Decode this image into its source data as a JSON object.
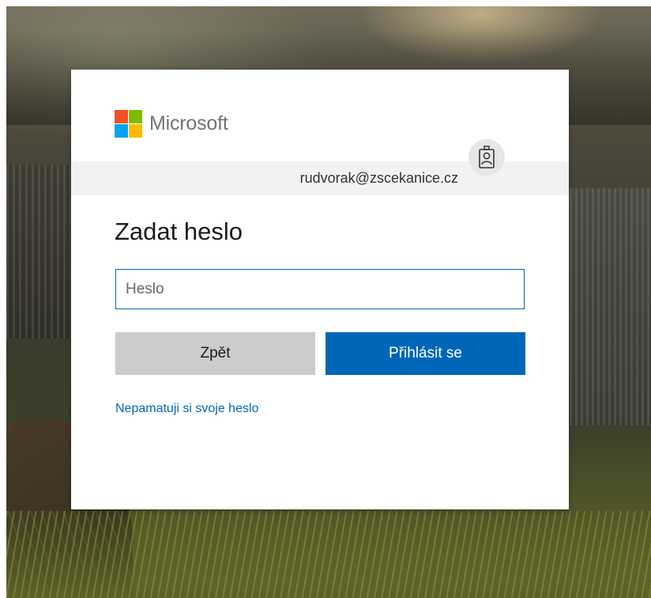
{
  "brand": {
    "name": "Microsoft",
    "logo_colors": [
      "#f25022",
      "#7fba00",
      "#00a4ef",
      "#ffb900"
    ],
    "wordmark_color": "#737373"
  },
  "identity": {
    "email": "rudvorak@zscekanice.cz",
    "badge_icon": "id-badge-icon"
  },
  "title": "Zadat heslo",
  "password": {
    "placeholder": "Heslo",
    "value": ""
  },
  "buttons": {
    "back_label": "Zpět",
    "signin_label": "Přihlásit se"
  },
  "links": {
    "forgot_password": "Nepamatuji si svoje heslo"
  },
  "colors": {
    "accent": "#0067b8",
    "secondary_button": "#cccccc",
    "identity_bar": "#f2f2f2"
  }
}
